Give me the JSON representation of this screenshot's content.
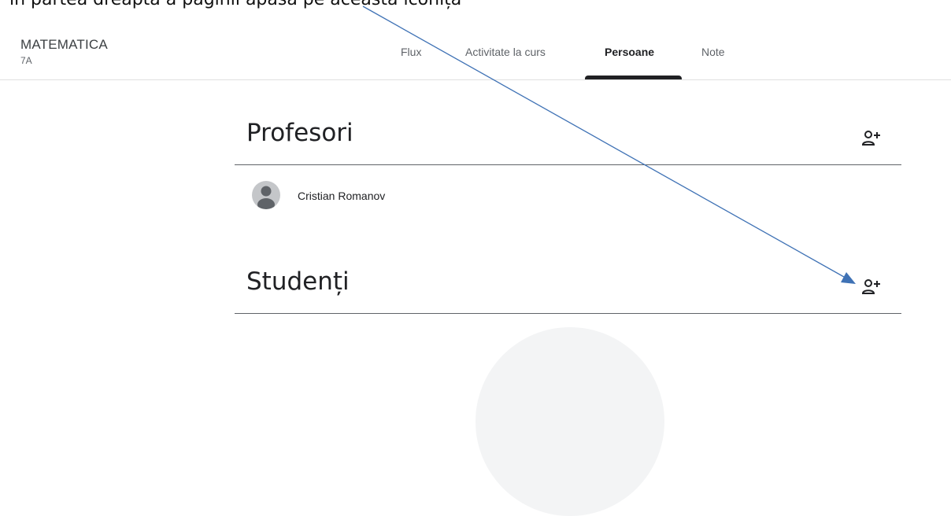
{
  "caption_fragment": "în partea dreaptă a paginii apasă pe aceasta iconiță",
  "class": {
    "title": "MATEMATICA",
    "section": "7A"
  },
  "tabs": [
    {
      "label": "Flux",
      "active": false
    },
    {
      "label": "Activitate la curs",
      "active": false
    },
    {
      "label": "Persoane",
      "active": true
    },
    {
      "label": "Note",
      "active": false
    }
  ],
  "teachers": {
    "heading": "Profesori",
    "add_icon": "person-add-icon",
    "people": [
      {
        "name": "Cristian Romanov"
      }
    ]
  },
  "students": {
    "heading": "Studenți",
    "add_icon": "person-add-icon",
    "people": []
  },
  "colors": {
    "annotation_arrow": "#3f72b5",
    "divider": "#5f6368",
    "active_tab": "#202124"
  }
}
